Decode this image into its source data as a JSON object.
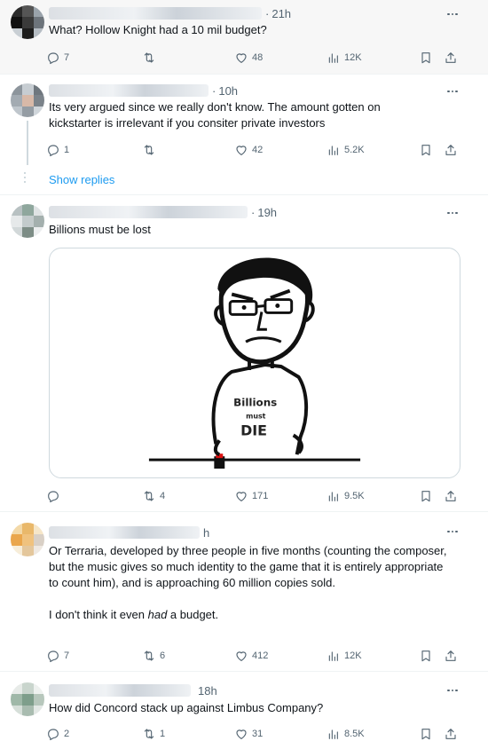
{
  "tweets": [
    {
      "time": "21h",
      "text": "What? Hollow Knight had a 10 mil budget?",
      "replies": "7",
      "retweets": "",
      "likes": "48",
      "views": "12K"
    },
    {
      "time": "10h",
      "text": "Its very argued since we really don't know. The amount gotten on kickstarter is irrelevant if you consiter private investors",
      "replies": "1",
      "retweets": "",
      "likes": "42",
      "views": "5.2K"
    },
    {
      "time": "19h",
      "text": "Billions must be lost",
      "replies": "",
      "retweets": "4",
      "likes": "171",
      "views": "9.5K",
      "meme": {
        "shirt_line1": "Billions",
        "shirt_line2": "must",
        "shirt_line3": "DIE"
      }
    },
    {
      "time": "h",
      "text_para1": "Or Terraria, developed by three people in five months (counting the composer, but the music gives so much identity to the game that it is entirely appropriate to count him), and is approaching 60 million copies sold.",
      "text_para2_before": "I don't think it even ",
      "text_para2_em": "had",
      "text_para2_after": " a budget.",
      "replies": "7",
      "retweets": "6",
      "likes": "412",
      "views": "12K"
    },
    {
      "time": "18h",
      "text": "How did Concord stack up against Limbus Company?",
      "replies": "2",
      "retweets": "1",
      "likes": "31",
      "views": "8.5K"
    }
  ],
  "show_replies_label": "Show replies",
  "icons": {
    "reply": "reply-icon",
    "retweet": "retweet-icon",
    "like": "heart-icon",
    "views": "views-icon",
    "bookmark": "bookmark-icon",
    "share": "share-icon",
    "more": "more-icon"
  },
  "colors": {
    "link": "#1d9bf0",
    "muted": "#536471",
    "highlight_bg": "#f7f7f7"
  }
}
